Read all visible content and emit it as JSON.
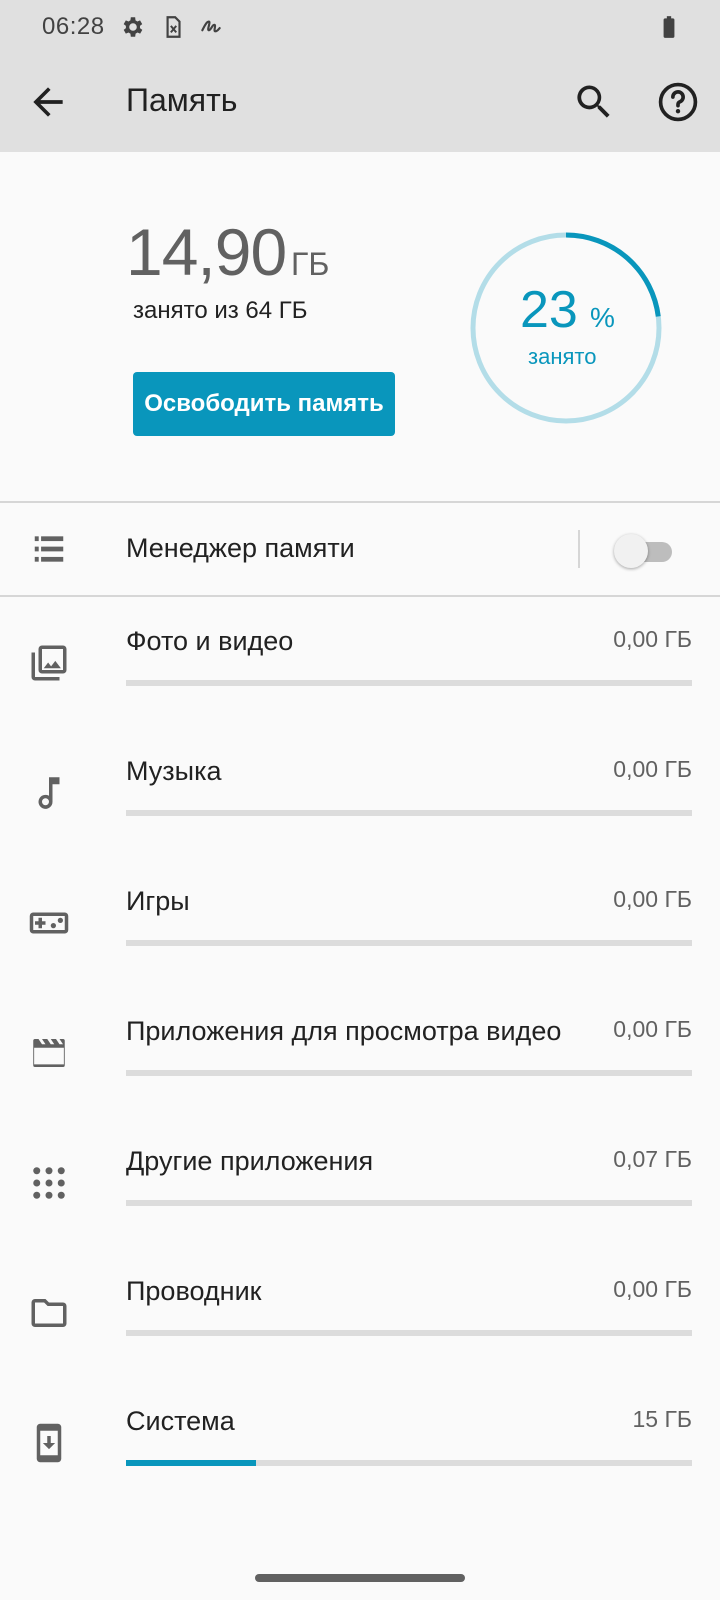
{
  "status_bar": {
    "time": "06:28",
    "icons": [
      "settings-icon",
      "sim-card-icon",
      "signature-icon",
      "battery-icon"
    ]
  },
  "app_bar": {
    "title": "Память",
    "back_icon": "arrow-back-icon",
    "search_icon": "search-icon",
    "help_icon": "help-circle-icon"
  },
  "summary": {
    "used_value": "14,90",
    "used_unit": "ГБ",
    "used_caption": "занято из 64 ГБ",
    "free_button": "Освободить память",
    "ring_percent": "23",
    "ring_percent_sign": "%",
    "ring_caption": "занято",
    "ring_fraction": 0.23
  },
  "storage_manager": {
    "label": "Менеджер памяти",
    "icon": "storage-manager-icon",
    "enabled": false
  },
  "categories": [
    {
      "label": "Фото и видео",
      "size": "0,00 ГБ",
      "icon": "photo-library-icon",
      "fraction": 0.0
    },
    {
      "label": "Музыка",
      "size": "0,00 ГБ",
      "icon": "music-note-icon",
      "fraction": 0.0
    },
    {
      "label": "Игры",
      "size": "0,00 ГБ",
      "icon": "gamepad-icon",
      "fraction": 0.0
    },
    {
      "label": "Приложения для просмотра видео",
      "size": "0,00 ГБ",
      "icon": "movie-icon",
      "fraction": 0.0
    },
    {
      "label": "Другие приложения",
      "size": "0,07 ГБ",
      "icon": "apps-grid-icon",
      "fraction": 0.0
    },
    {
      "label": "Проводник",
      "size": "0,00 ГБ",
      "icon": "folder-icon",
      "fraction": 0.0
    },
    {
      "label": "Система",
      "size": "15 ГБ",
      "icon": "system-update-icon",
      "fraction": 0.23
    }
  ],
  "colors": {
    "accent": "#0996bc",
    "ring_track": "#b3dde8",
    "bar_track": "#dcdcdc",
    "app_bar": "#e0e0e0",
    "background": "#fafafa"
  }
}
